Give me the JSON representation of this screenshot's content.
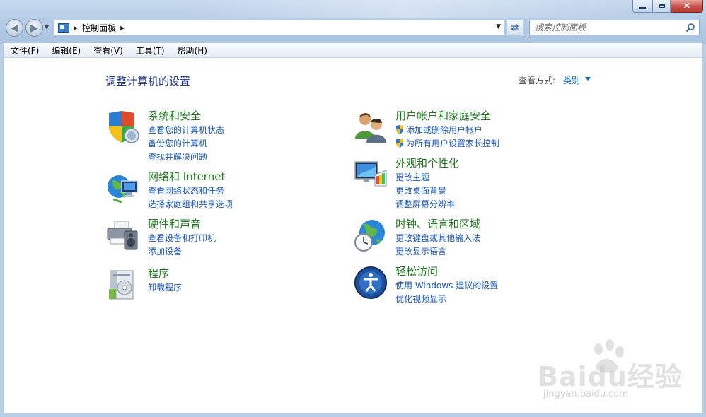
{
  "window": {
    "minimize_label": "",
    "close_label": "×"
  },
  "address_bar": {
    "path": "控制面板"
  },
  "search": {
    "placeholder": "搜索控制面板"
  },
  "menu": [
    "文件(F)",
    "编辑(E)",
    "查看(V)",
    "工具(T)",
    "帮助(H)"
  ],
  "main": {
    "title": "调整计算机的设置",
    "view_by_label": "查看方式:",
    "view_by_value": "类别"
  },
  "categories": [
    {
      "title": "系统和安全",
      "icon": "shield-computer-icon",
      "links": [
        "查看您的计算机状态",
        "备份您的计算机",
        "查找并解决问题"
      ]
    },
    {
      "title": "网络和 Internet",
      "icon": "network-globe-icon",
      "links": [
        "查看网络状态和任务",
        "选择家庭组和共享选项"
      ]
    },
    {
      "title": "硬件和声音",
      "icon": "printer-speaker-icon",
      "links": [
        "查看设备和打印机",
        "添加设备"
      ]
    },
    {
      "title": "程序",
      "icon": "programs-icon",
      "links": [
        "卸载程序"
      ]
    },
    {
      "title": "用户帐户和家庭安全",
      "icon": "users-icon",
      "links": [
        "添加或删除用户帐户",
        "为所有用户设置家长控制"
      ]
    },
    {
      "title": "外观和个性化",
      "icon": "monitor-palette-icon",
      "links": [
        "更改主题",
        "更改桌面背景",
        "调整屏幕分辨率"
      ]
    },
    {
      "title": "时钟、语言和区域",
      "icon": "globe-clock-icon",
      "links": [
        "更改键盘或其他输入法",
        "更改显示语言"
      ]
    },
    {
      "title": "轻松访问",
      "icon": "ease-of-access-icon",
      "links": [
        "使用 Windows 建议的设置",
        "优化视频显示"
      ]
    }
  ],
  "watermark": {
    "text": "Baidu经验",
    "subtext": "jingyan.baidu.com"
  },
  "colors": {
    "category_title": "#1e7a1e",
    "link": "#1a57b8",
    "heading": "#1e3287"
  }
}
